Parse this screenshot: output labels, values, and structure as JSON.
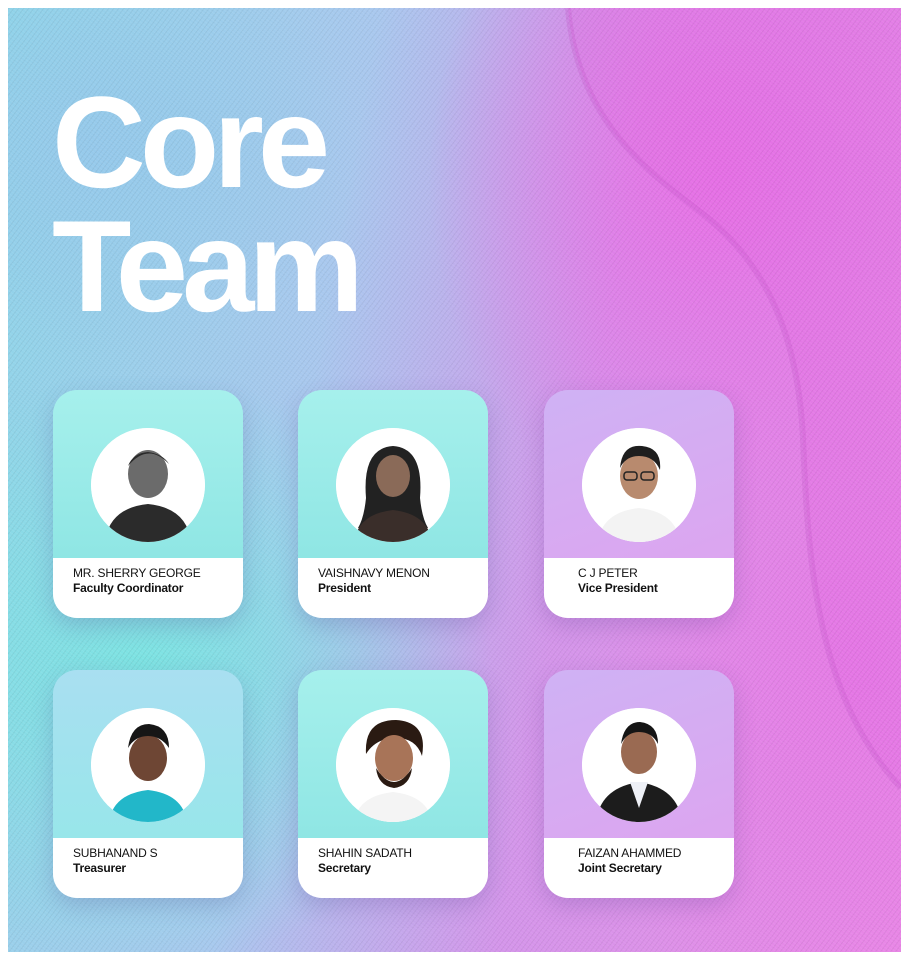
{
  "title": {
    "line1": "Core",
    "line2": "Team"
  },
  "members": [
    {
      "name": "MR. SHERRY GEORGE",
      "role": "Faculty Coordinator"
    },
    {
      "name": "VAISHNAVY MENON",
      "role": "President"
    },
    {
      "name": "C J PETER",
      "role": "Vice President"
    },
    {
      "name": "SUBHANAND S",
      "role": "Treasurer"
    },
    {
      "name": "SHAHIN SADATH",
      "role": "Secretary"
    },
    {
      "name": "FAIZAN AHAMMED",
      "role": "Joint Secretary"
    }
  ],
  "colors": {
    "teal": "#9eeeea",
    "violet": "#d8a9f2",
    "pink": "#e98be6",
    "title": "#ffffff"
  }
}
